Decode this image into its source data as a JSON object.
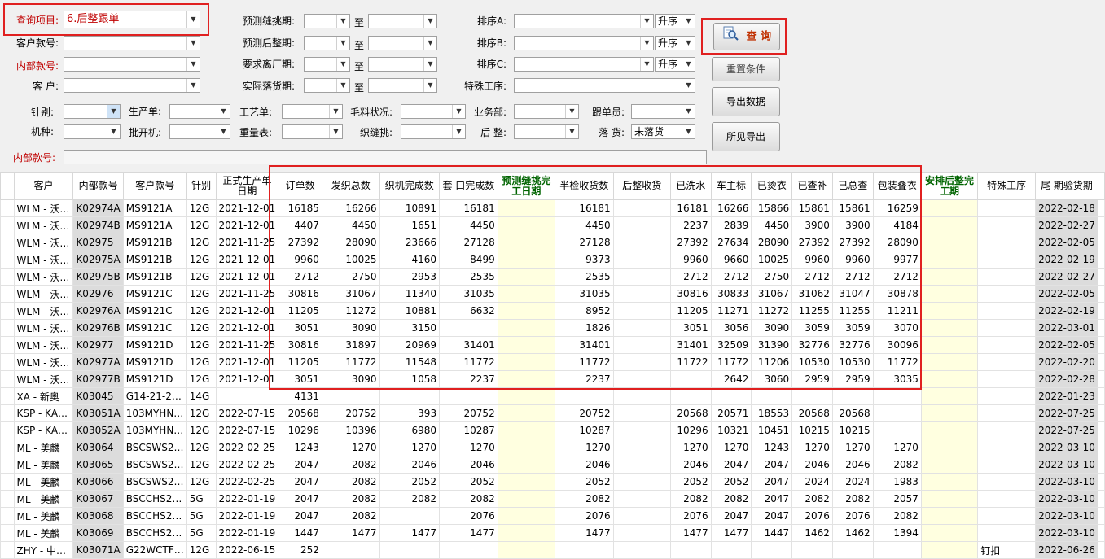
{
  "filters": {
    "query_item_label": "查询项目:",
    "query_item_value": "6.后整跟单",
    "customer_style_label": "客户款号:",
    "internal_style_label": "内部款号:",
    "customer_label": "客 户:",
    "pred_seam_label": "预测缝挑期:",
    "pred_finish_label": "预测后整期:",
    "req_leave_label": "要求离厂期:",
    "actual_ship_label": "实际落货期:",
    "to_label": "至",
    "sort_a_label": "排序A:",
    "sort_b_label": "排序B:",
    "sort_c_label": "排序C:",
    "asc_label": "升序",
    "special_process_label": "特殊工序:",
    "needle_label": "针别:",
    "production_label": "生产单:",
    "craft_label": "工艺单:",
    "yarn_status_label": "毛料状况:",
    "business_label": "业务部:",
    "merch_label": "跟单员:",
    "machine_label": "机种:",
    "batch_label": "批开机:",
    "weigh_label": "重量表:",
    "knit_seam_label": "织缝挑:",
    "finishing_label": "后 整:",
    "shipping_label": "落 货:",
    "shipping_value": "未落货",
    "internal_style2_label": "内部款号:"
  },
  "buttons": {
    "query": "查 询",
    "reset": "重置条件",
    "export": "导出数据",
    "export_visible": "所见导出"
  },
  "table": {
    "headers": [
      "客户",
      "内部款号",
      "客户款号",
      "针别",
      "正式生产单日期",
      "订单数",
      "发织总数",
      "织机完成数",
      "套 口完成数",
      "预测缝挑完工日期",
      "半检收货数",
      "后整收货",
      "已洗水",
      "车主标",
      "已烫衣",
      "已查补",
      "已总查",
      "包装叠衣",
      "安排后整完工期",
      "特殊工序",
      "尾 期验货期"
    ],
    "rows": [
      [
        "WLM - 沃…",
        "K02974A",
        "MS9121A",
        "12G",
        "2021-12-01",
        "16185",
        "16266",
        "10891",
        "16181",
        "",
        "16181",
        "",
        "16181",
        "16266",
        "15866",
        "15861",
        "15861",
        "16259",
        "",
        "",
        "2022-02-18"
      ],
      [
        "WLM - 沃…",
        "K02974B",
        "MS9121A",
        "12G",
        "2021-12-01",
        "4407",
        "4450",
        "1651",
        "4450",
        "",
        "4450",
        "",
        "2237",
        "2839",
        "4450",
        "3900",
        "3900",
        "4184",
        "",
        "",
        "2022-02-27"
      ],
      [
        "WLM - 沃…",
        "K02975",
        "MS9121B",
        "12G",
        "2021-11-25",
        "27392",
        "28090",
        "23666",
        "27128",
        "",
        "27128",
        "",
        "27392",
        "27634",
        "28090",
        "27392",
        "27392",
        "28090",
        "",
        "",
        "2022-02-05"
      ],
      [
        "WLM - 沃…",
        "K02975A",
        "MS9121B",
        "12G",
        "2021-12-01",
        "9960",
        "10025",
        "4160",
        "8499",
        "",
        "9373",
        "",
        "9960",
        "9660",
        "10025",
        "9960",
        "9960",
        "9977",
        "",
        "",
        "2022-02-19"
      ],
      [
        "WLM - 沃…",
        "K02975B",
        "MS9121B",
        "12G",
        "2021-12-01",
        "2712",
        "2750",
        "2953",
        "2535",
        "",
        "2535",
        "",
        "2712",
        "2712",
        "2750",
        "2712",
        "2712",
        "2712",
        "",
        "",
        "2022-02-27"
      ],
      [
        "WLM - 沃…",
        "K02976",
        "MS9121C",
        "12G",
        "2021-11-25",
        "30816",
        "31067",
        "11340",
        "31035",
        "",
        "31035",
        "",
        "30816",
        "30833",
        "31067",
        "31062",
        "31047",
        "30878",
        "",
        "",
        "2022-02-05"
      ],
      [
        "WLM - 沃…",
        "K02976A",
        "MS9121C",
        "12G",
        "2021-12-01",
        "11205",
        "11272",
        "10881",
        "6632",
        "",
        "8952",
        "",
        "11205",
        "11271",
        "11272",
        "11255",
        "11255",
        "11211",
        "",
        "",
        "2022-02-19"
      ],
      [
        "WLM - 沃…",
        "K02976B",
        "MS9121C",
        "12G",
        "2021-12-01",
        "3051",
        "3090",
        "3150",
        "",
        "",
        "1826",
        "",
        "3051",
        "3056",
        "3090",
        "3059",
        "3059",
        "3070",
        "",
        "",
        "2022-03-01"
      ],
      [
        "WLM - 沃…",
        "K02977",
        "MS9121D",
        "12G",
        "2021-11-25",
        "30816",
        "31897",
        "20969",
        "31401",
        "",
        "31401",
        "",
        "31401",
        "32509",
        "31390",
        "32776",
        "32776",
        "30096",
        "",
        "",
        "2022-02-05"
      ],
      [
        "WLM - 沃…",
        "K02977A",
        "MS9121D",
        "12G",
        "2021-12-01",
        "11205",
        "11772",
        "11548",
        "11772",
        "",
        "11772",
        "",
        "11722",
        "11772",
        "11206",
        "10530",
        "10530",
        "11772",
        "",
        "",
        "2022-02-20"
      ],
      [
        "WLM - 沃…",
        "K02977B",
        "MS9121D",
        "12G",
        "2021-12-01",
        "3051",
        "3090",
        "1058",
        "2237",
        "",
        "2237",
        "",
        "",
        "2642",
        "3060",
        "2959",
        "2959",
        "3035",
        "",
        "",
        "2022-02-28"
      ],
      [
        "XA - 新奥",
        "K03045",
        "G14-21-2…",
        "14G",
        "",
        "4131",
        "",
        "",
        "",
        "",
        "",
        "",
        "",
        "",
        "",
        "",
        "",
        "",
        "",
        "",
        "2022-01-23"
      ],
      [
        "KSP - KA…",
        "K03051A",
        "103MYHN…",
        "12G",
        "2022-07-15",
        "20568",
        "20752",
        "393",
        "20752",
        "",
        "20752",
        "",
        "20568",
        "20571",
        "18553",
        "20568",
        "20568",
        "",
        "",
        "",
        "2022-07-25"
      ],
      [
        "KSP - KA…",
        "K03052A",
        "103MYHN…",
        "12G",
        "2022-07-15",
        "10296",
        "10396",
        "6980",
        "10287",
        "",
        "10287",
        "",
        "10296",
        "10321",
        "10451",
        "10215",
        "10215",
        "",
        "",
        "",
        "2022-07-25"
      ],
      [
        "ML - 美麟",
        "K03064",
        "BSCSWS2…",
        "12G",
        "2022-02-25",
        "1243",
        "1270",
        "1270",
        "1270",
        "",
        "1270",
        "",
        "1270",
        "1270",
        "1243",
        "1270",
        "1270",
        "1270",
        "",
        "",
        "2022-03-10"
      ],
      [
        "ML - 美麟",
        "K03065",
        "BSCSWS2…",
        "12G",
        "2022-02-25",
        "2047",
        "2082",
        "2046",
        "2046",
        "",
        "2046",
        "",
        "2046",
        "2047",
        "2047",
        "2046",
        "2046",
        "2082",
        "",
        "",
        "2022-03-10"
      ],
      [
        "ML - 美麟",
        "K03066",
        "BSCSWS2…",
        "12G",
        "2022-02-25",
        "2047",
        "2082",
        "2052",
        "2052",
        "",
        "2052",
        "",
        "2052",
        "2052",
        "2047",
        "2024",
        "2024",
        "1983",
        "",
        "",
        "2022-03-10"
      ],
      [
        "ML - 美麟",
        "K03067",
        "BSCCHS2…",
        "5G",
        "2022-01-19",
        "2047",
        "2082",
        "2082",
        "2082",
        "",
        "2082",
        "",
        "2082",
        "2082",
        "2047",
        "2082",
        "2082",
        "2057",
        "",
        "",
        "2022-03-10"
      ],
      [
        "ML - 美麟",
        "K03068",
        "BSCCHS2…",
        "5G",
        "2022-01-19",
        "2047",
        "2082",
        "",
        "2076",
        "",
        "2076",
        "",
        "2076",
        "2047",
        "2047",
        "2076",
        "2076",
        "2082",
        "",
        "",
        "2022-03-10"
      ],
      [
        "ML - 美麟",
        "K03069",
        "BSCCHS2…",
        "5G",
        "2022-01-19",
        "1447",
        "1477",
        "1477",
        "1477",
        "",
        "1477",
        "",
        "1477",
        "1477",
        "1447",
        "1462",
        "1462",
        "1394",
        "",
        "",
        "2022-03-10"
      ],
      [
        "ZHY - 中…",
        "K03071A",
        "G22WCTF…",
        "12G",
        "2022-06-15",
        "252",
        "",
        "",
        "",
        "",
        "",
        "",
        "",
        "",
        "",
        "",
        "",
        "",
        "",
        "钉扣",
        "2022-06-26"
      ]
    ]
  }
}
